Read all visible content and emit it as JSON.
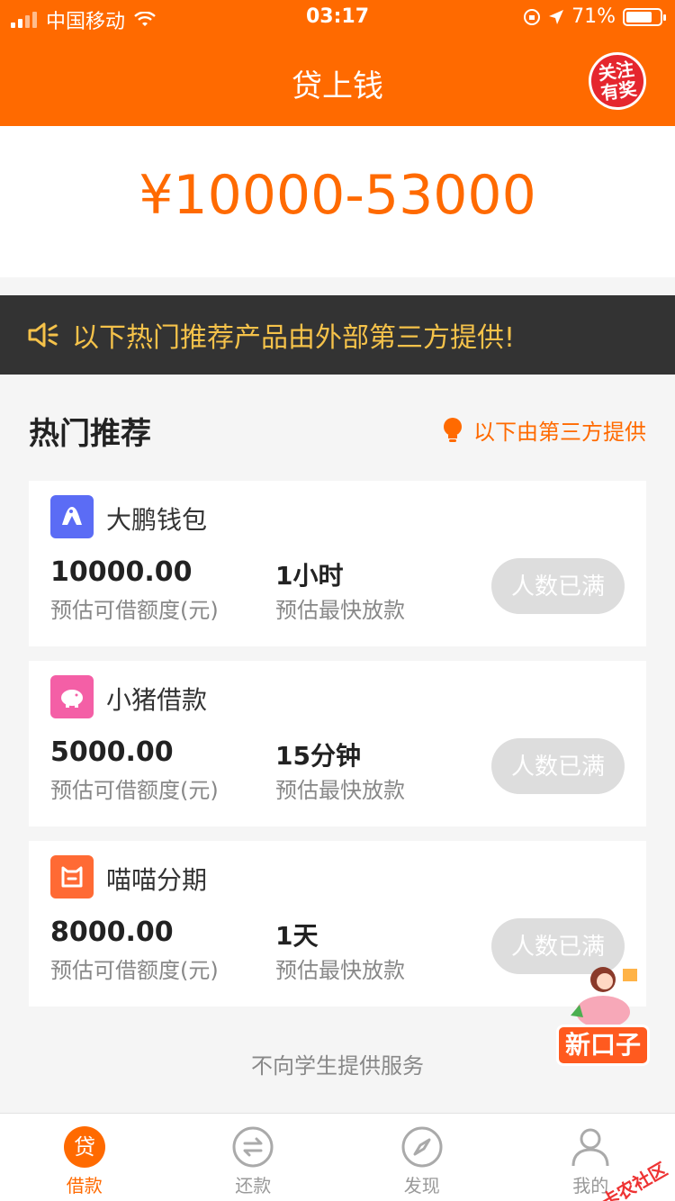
{
  "status": {
    "carrier": "中国移动",
    "time": "03:17",
    "battery": "71%"
  },
  "header": {
    "title": "贷上钱",
    "badge": "关注有奖"
  },
  "amount": {
    "range": "¥10000-53000"
  },
  "notice": {
    "text": "以下热门推荐产品由外部第三方提供!"
  },
  "section": {
    "title": "热门推荐",
    "note": "以下由第三方提供"
  },
  "products": [
    {
      "name": "大鹏钱包",
      "amount": "10000.00",
      "amount_label": "预估可借额度(元)",
      "time": "1小时",
      "time_label": "预估最快放款",
      "button": "人数已满",
      "logo_color": "#5b6cf5"
    },
    {
      "name": "小猪借款",
      "amount": "5000.00",
      "amount_label": "预估可借额度(元)",
      "time": "15分钟",
      "time_label": "预估最快放款",
      "button": "人数已满",
      "logo_color": "#f45fa6"
    },
    {
      "name": "喵喵分期",
      "amount": "8000.00",
      "amount_label": "预估可借额度(元)",
      "time": "1天",
      "time_label": "预估最快放款",
      "button": "人数已满",
      "logo_color": "#ff6a34"
    }
  ],
  "footer_note": "不向学生提供服务",
  "promo": {
    "label": "新口子"
  },
  "tabs": [
    {
      "label": "借款",
      "icon": "loan-icon",
      "active": true
    },
    {
      "label": "还款",
      "icon": "repay-icon",
      "active": false
    },
    {
      "label": "发现",
      "icon": "compass-icon",
      "active": false
    },
    {
      "label": "我的",
      "icon": "profile-icon",
      "active": false
    }
  ],
  "watermark": "卡农社区",
  "colors": {
    "accent": "#ff6a00",
    "notice_bg": "#333333",
    "notice_text": "#f5c24a",
    "disabled_button": "#dddddd"
  }
}
